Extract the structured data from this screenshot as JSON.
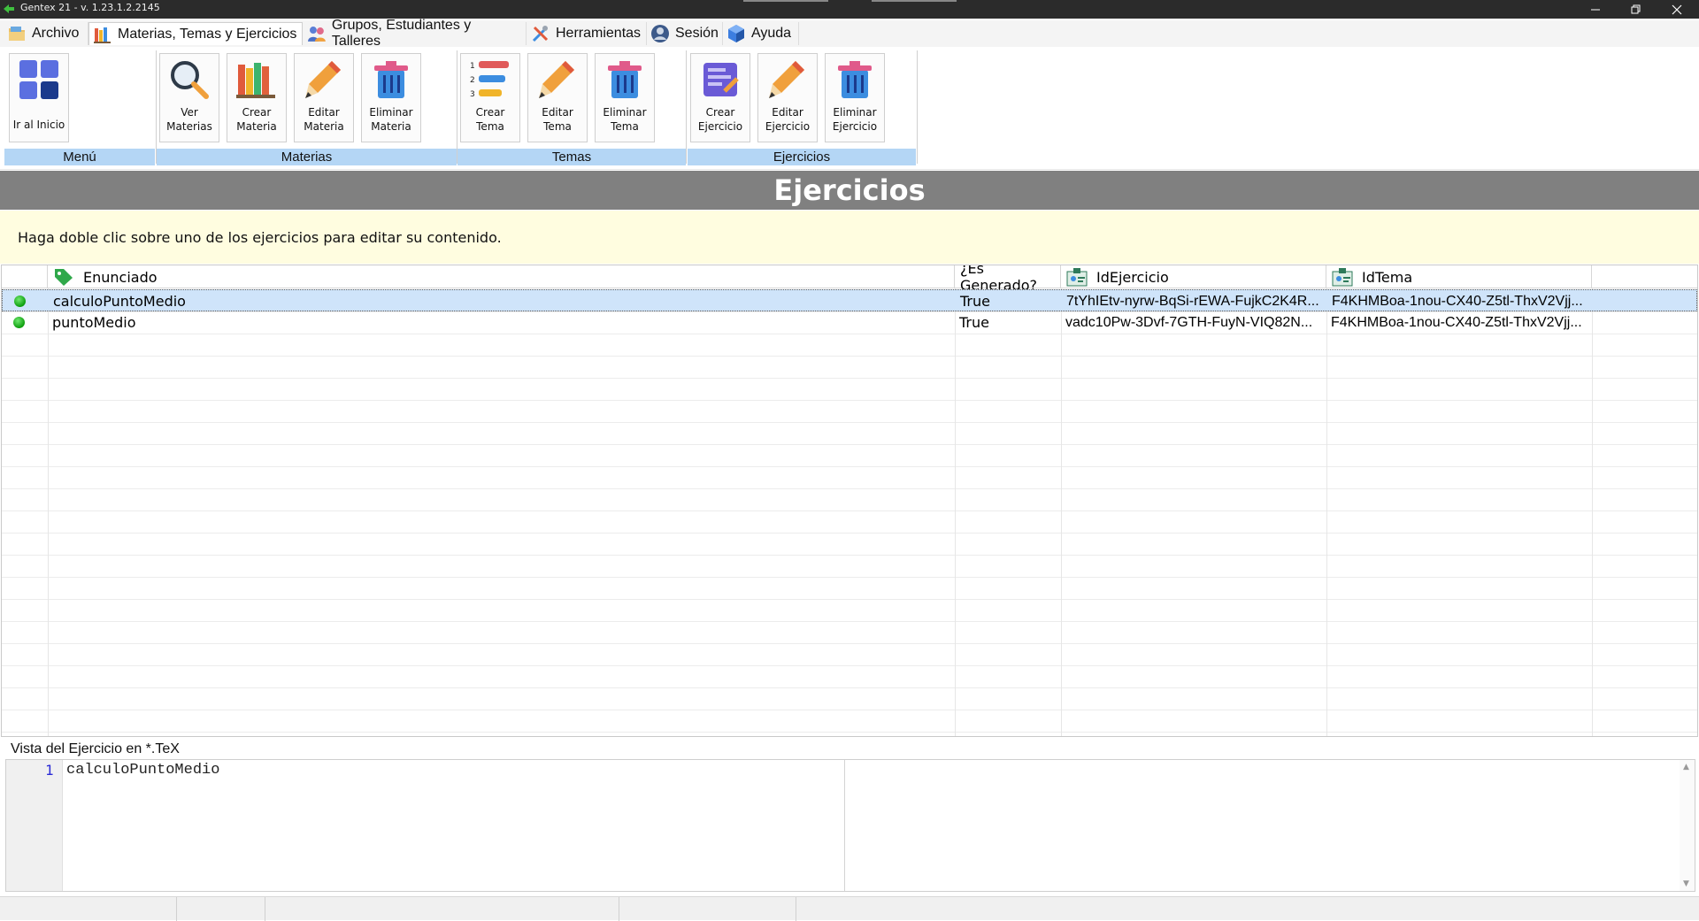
{
  "window": {
    "title": "Gentex 21 - v. 1.23.1.2.2145",
    "controls": [
      "minimize",
      "restore",
      "close"
    ]
  },
  "menu": [
    {
      "label": "Archivo",
      "icon": "folder-icon"
    },
    {
      "label": "Materias, Temas y Ejercicios",
      "icon": "books-icon",
      "active": true
    },
    {
      "label": "Grupos, Estudiantes y Talleres",
      "icon": "group-icon"
    },
    {
      "label": "Herramientas",
      "icon": "tools-icon"
    },
    {
      "label": "Sesión",
      "icon": "user-icon"
    },
    {
      "label": "Ayuda",
      "icon": "help-cube-icon"
    }
  ],
  "ribbon": {
    "groups": [
      {
        "caption": "Menú",
        "buttons": [
          {
            "label": "Ir al Inicio",
            "icon": "home-grid-icon"
          }
        ]
      },
      {
        "caption": "Materias",
        "buttons": [
          {
            "label": "Ver\nMaterias",
            "icon": "magnifier-icon"
          },
          {
            "label": "Crear\nMateria",
            "icon": "books-icon"
          },
          {
            "label": "Editar\nMateria",
            "icon": "pencil-icon"
          },
          {
            "label": "Eliminar\nMateria",
            "icon": "trash-icon"
          }
        ]
      },
      {
        "caption": "Temas",
        "buttons": [
          {
            "label": "Crear\nTema",
            "icon": "numbered-list-icon"
          },
          {
            "label": "Editar\nTema",
            "icon": "pencil-icon"
          },
          {
            "label": "Eliminar\nTema",
            "icon": "trash-icon"
          }
        ]
      },
      {
        "caption": "Ejercicios",
        "buttons": [
          {
            "label": "Crear\nEjercicio",
            "icon": "exercise-icon"
          },
          {
            "label": "Editar\nEjercicio",
            "icon": "pencil-icon"
          },
          {
            "label": "Eliminar\nEjercicio",
            "icon": "trash-icon"
          }
        ]
      }
    ]
  },
  "header": {
    "title": "Ejercicios"
  },
  "hint": "Haga doble clic sobre uno de los ejercicios para editar su contenido.",
  "table": {
    "columns": [
      {
        "label": "",
        "icon": ""
      },
      {
        "label": "Enunciado",
        "icon": "tag-icon"
      },
      {
        "label": "¿Es Generado?",
        "icon": ""
      },
      {
        "label": "IdEjercicio",
        "icon": "id-card-icon"
      },
      {
        "label": "IdTema",
        "icon": "id-card-icon"
      }
    ],
    "rows": [
      {
        "status": "green",
        "enunciado": "calculoPuntoMedio",
        "generado": "True",
        "idEjercicio": "7tYhIEtv-nyrw-BqSi-rEWA-FujkC2K4R...",
        "idTema": "F4KHMBoa-1nou-CX40-Z5tl-ThxV2Vjj...",
        "selected": true
      },
      {
        "status": "green",
        "enunciado": "puntoMedio",
        "generado": "True",
        "idEjercicio": "vadc10Pw-3Dvf-7GTH-FuyN-VIQ82N...",
        "idTema": "F4KHMBoa-1nou-CX40-Z5tl-ThxV2Vjj...",
        "selected": false
      }
    ]
  },
  "tex": {
    "label": "Vista del Ejercicio en *.TeX",
    "line_number": "1",
    "code": "calculoPuntoMedio"
  },
  "colors": {
    "ribbon_caption": "#b4d6f5",
    "header_band": "#808080",
    "hint_bg": "#fffde0",
    "selected_row": "#cfe4fa",
    "status_green": "#0d9e0d"
  }
}
